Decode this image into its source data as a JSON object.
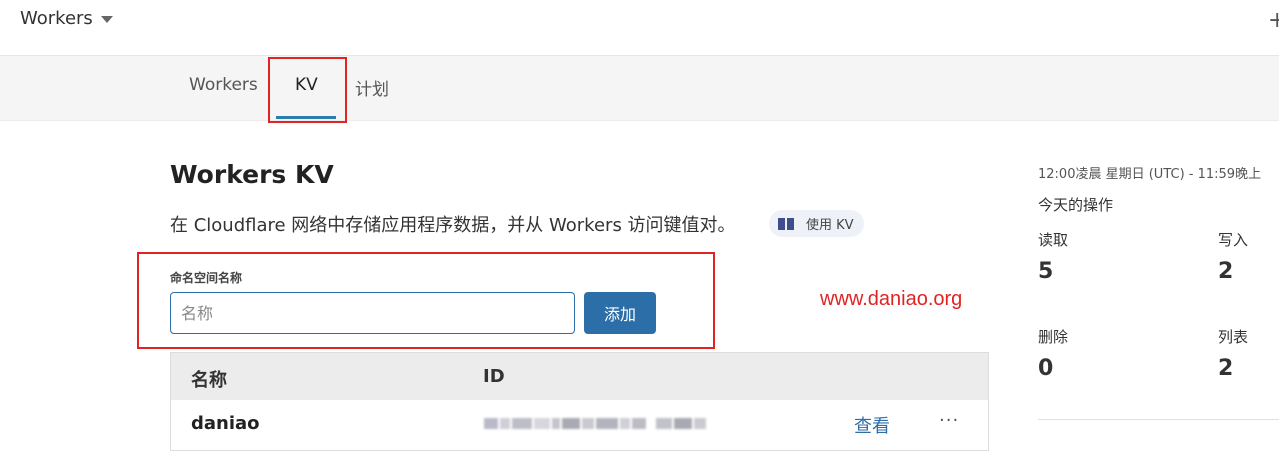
{
  "topbar": {
    "account_name": "Workers",
    "plus_icon": "plus-icon"
  },
  "tabs": [
    {
      "label": "Workers"
    },
    {
      "label": "KV"
    },
    {
      "label": "计划"
    }
  ],
  "main": {
    "title": "Workers KV",
    "description": "在 Cloudflare 网络中存储应用程序数据，并从 Workers 访问键值对。",
    "use_kv_label": "使用 KV",
    "use_kv_icon": "book-icon"
  },
  "form": {
    "label": "命名空间名称",
    "placeholder": "名称",
    "value": "",
    "add_button": "添加"
  },
  "watermark": "www.daniao.org",
  "table": {
    "headers": [
      "名称",
      "ID"
    ],
    "rows": [
      {
        "name": "daniao",
        "id_note": "",
        "action": "查看",
        "more": "···"
      }
    ]
  },
  "stats": {
    "range": "12:00凌晨 星期日 (UTC) - 11:59晚上",
    "heading": "今天的操作",
    "items": [
      {
        "label": "读取",
        "value": "5"
      },
      {
        "label": "写入",
        "value": "2"
      },
      {
        "label": "删除",
        "value": "0"
      },
      {
        "label": "列表",
        "value": "2"
      }
    ]
  },
  "colors": {
    "accent": "#2c6ea8",
    "highlight_red": "#e02424"
  }
}
